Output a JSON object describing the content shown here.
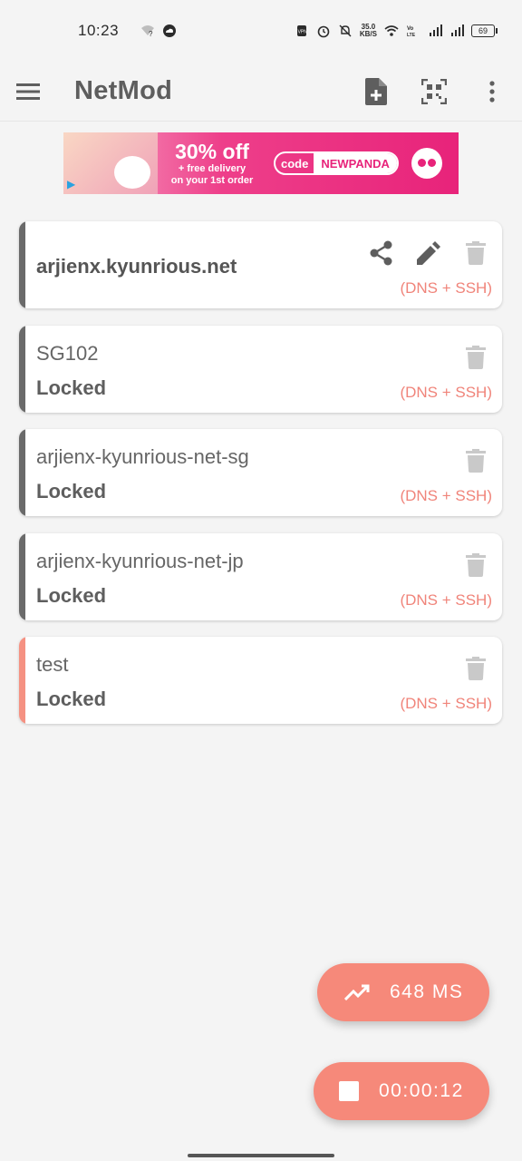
{
  "status_bar": {
    "time": "10:23",
    "net_speed_value": "35.0",
    "net_speed_unit": "KB/S",
    "battery": "69",
    "icons": [
      "wifi-question-icon",
      "cloud-icon",
      "vpn-icon",
      "alarm-icon",
      "mute-icon",
      "wifi-icon",
      "volte-icon",
      "signal-icon",
      "signal-icon",
      "battery-icon"
    ]
  },
  "app_bar": {
    "title": "NetMod",
    "icons": [
      "menu-icon",
      "new-file-icon",
      "qr-code-icon",
      "more-vert-icon"
    ]
  },
  "ad": {
    "headline": "30% off",
    "subline_1": "+ free delivery",
    "subline_2": "on your 1st order",
    "code_label": "code",
    "code_value": "NEWPANDA"
  },
  "servers": [
    {
      "name": "arjienx.kyunrious.net",
      "status": "",
      "type": "(DNS + SSH)",
      "actions": [
        "share-icon",
        "edit-icon",
        "delete-icon"
      ],
      "active": false
    },
    {
      "name": "SG102",
      "status": "Locked",
      "type": "(DNS + SSH)",
      "actions": [
        "delete-icon"
      ],
      "active": false
    },
    {
      "name": "arjienx-kyunrious-net-sg",
      "status": "Locked",
      "type": "(DNS + SSH)",
      "actions": [
        "delete-icon"
      ],
      "active": false
    },
    {
      "name": "arjienx-kyunrious-net-jp",
      "status": "Locked",
      "type": "(DNS + SSH)",
      "actions": [
        "delete-icon"
      ],
      "active": false
    },
    {
      "name": "test",
      "status": "Locked",
      "type": "(DNS + SSH)",
      "actions": [
        "delete-icon"
      ],
      "active": true
    }
  ],
  "fab_ping": {
    "icon": "trending-up-icon",
    "label": "648 MS"
  },
  "fab_timer": {
    "icon": "stop-icon",
    "label": "00:00:12"
  },
  "colors": {
    "accent": "#f6897a",
    "inactive_bar": "#6a6a6a",
    "type_text": "#f0847a"
  }
}
